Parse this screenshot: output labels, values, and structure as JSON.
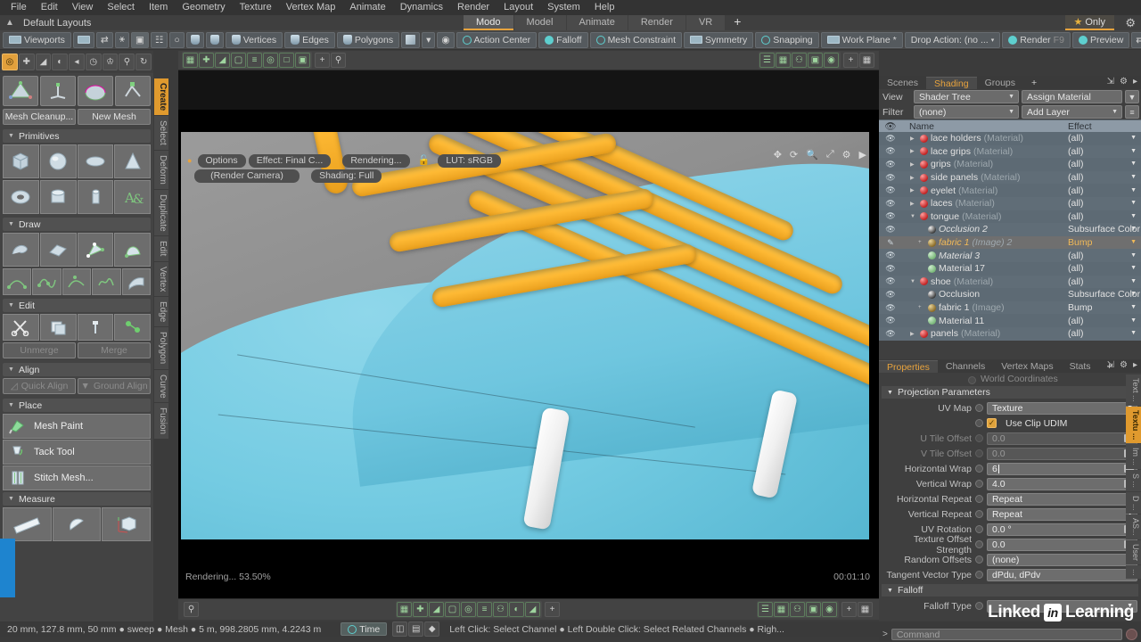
{
  "menu": {
    "items": [
      "File",
      "Edit",
      "View",
      "Select",
      "Item",
      "Geometry",
      "Texture",
      "Vertex Map",
      "Animate",
      "Dynamics",
      "Render",
      "Layout",
      "System",
      "Help"
    ]
  },
  "layoutbar": {
    "title": "Default Layouts",
    "tabs": [
      {
        "label": "Modo",
        "active": true
      },
      {
        "label": "Model",
        "active": false
      },
      {
        "label": "Animate",
        "active": false
      },
      {
        "label": "Render",
        "active": false
      },
      {
        "label": "VR",
        "active": false
      },
      {
        "label": "+",
        "active": false
      }
    ],
    "only_label": "Only",
    "star_icon": "star-icon",
    "gear_icon": "gear-icon"
  },
  "toolbar": {
    "viewports": "Viewports",
    "vertices": "Vertices",
    "edges": "Edges",
    "polygons": "Polygons",
    "action_center": "Action Center",
    "falloff": "Falloff",
    "mesh_constraint": "Mesh Constraint",
    "symmetry": "Symmetry",
    "snapping": "Snapping",
    "work_plane": "Work Plane *",
    "drop_action": "Drop Action: (no ...",
    "render": "Render",
    "render_key": "F9",
    "preview": "Preview",
    "overflow": ">>"
  },
  "left_tool_tabs": [
    "Create",
    "Select",
    "Deform",
    "Duplicate",
    "Edit",
    "Vertex",
    "Edge",
    "Polygon",
    "Curve",
    "Fusion"
  ],
  "left_tool_tab_active": "Create",
  "left_panel": {
    "buttons": [
      {
        "label": "Mesh Cleanup...",
        "dim": false
      },
      {
        "label": "New Mesh",
        "dim": false
      }
    ],
    "sections": [
      {
        "title": "Primitives"
      },
      {
        "title": "Draw"
      },
      {
        "title": "Edit"
      },
      {
        "title": "Align"
      },
      {
        "title": "Place"
      },
      {
        "title": "Measure"
      }
    ],
    "edit_buttons": [
      {
        "label": "Unmerge",
        "dim": true
      },
      {
        "label": "Merge",
        "dim": true
      }
    ],
    "align_buttons": [
      {
        "label": "Quick Align",
        "dim": true,
        "icon": "quick-align-icon"
      },
      {
        "label": "Ground Align",
        "dim": true,
        "icon": "ground-align-icon"
      }
    ],
    "place_items": [
      {
        "label": "Mesh Paint",
        "icon": "mesh-paint-icon"
      },
      {
        "label": "Tack Tool",
        "icon": "tack-tool-icon"
      },
      {
        "label": "Stitch Mesh...",
        "icon": "stitch-mesh-icon"
      }
    ]
  },
  "viewport": {
    "chips_row1": [
      "Options",
      "Effect: Final C...",
      "Rendering...",
      "LUT: sRGB"
    ],
    "chips_row2": [
      "(Render Camera)",
      "Shading: Full"
    ],
    "lock_icon": "unlock-icon",
    "nav_icons": [
      "pan-icon",
      "rotate-icon",
      "zoom-icon",
      "fit-icon",
      "gear-icon",
      "play-icon"
    ],
    "render_status": "Rendering... 53.50%",
    "render_time": "00:01:10"
  },
  "shader_tree": {
    "tabs": [
      {
        "label": "Scenes",
        "active": false
      },
      {
        "label": "Shading",
        "active": true
      },
      {
        "label": "Groups",
        "active": false
      },
      {
        "label": "+",
        "active": false
      }
    ],
    "view_label": "View",
    "view_value": "Shader Tree",
    "assign_material": "Assign Material",
    "filter_label": "Filter",
    "filter_value": "(none)",
    "add_layer": "Add Layer",
    "col_name": "Name",
    "col_effect": "Effect",
    "rows": [
      {
        "name": "lace holders",
        "type": "(Material)",
        "effect": "(all)",
        "indent": 1,
        "tri": "▶",
        "ball": "red",
        "selected": false,
        "italic": false
      },
      {
        "name": "lace grips",
        "type": "(Material)",
        "effect": "(all)",
        "indent": 1,
        "tri": "▶",
        "ball": "red",
        "selected": false,
        "italic": false
      },
      {
        "name": "grips",
        "type": "(Material)",
        "effect": "(all)",
        "indent": 1,
        "tri": "▶",
        "ball": "red",
        "selected": false,
        "italic": false
      },
      {
        "name": "side panels",
        "type": "(Material)",
        "effect": "(all)",
        "indent": 1,
        "tri": "▶",
        "ball": "red",
        "selected": false,
        "italic": false
      },
      {
        "name": "eyelet",
        "type": "(Material)",
        "effect": "(all)",
        "indent": 1,
        "tri": "▶",
        "ball": "red",
        "selected": false,
        "italic": false
      },
      {
        "name": "laces",
        "type": "(Material)",
        "effect": "(all)",
        "indent": 1,
        "tri": "▶",
        "ball": "red",
        "selected": false,
        "italic": false
      },
      {
        "name": "tongue",
        "type": "(Material)",
        "effect": "(all)",
        "indent": 1,
        "tri": "▼",
        "ball": "red",
        "selected": false,
        "italic": false
      },
      {
        "name": "Occlusion 2",
        "type": "",
        "effect": "Subsurface Color",
        "indent": 2,
        "tri": "",
        "ball": "dark",
        "selected": false,
        "italic": true
      },
      {
        "name": "fabric 1",
        "type": "(Image) 2",
        "effect": "Bump",
        "indent": 2,
        "tri": "+",
        "ball": "tan",
        "selected": true,
        "italic": true
      },
      {
        "name": "Material 3",
        "type": "",
        "effect": "(all)",
        "indent": 2,
        "tri": "",
        "ball": "green",
        "selected": false,
        "italic": true
      },
      {
        "name": "Material 17",
        "type": "",
        "effect": "(all)",
        "indent": 2,
        "tri": "",
        "ball": "green",
        "selected": false,
        "italic": false
      },
      {
        "name": "shoe",
        "type": "(Material)",
        "effect": "(all)",
        "indent": 1,
        "tri": "▼",
        "ball": "red",
        "selected": false,
        "italic": false
      },
      {
        "name": "Occlusion",
        "type": "",
        "effect": "Subsurface Color",
        "indent": 2,
        "tri": "",
        "ball": "dark",
        "selected": false,
        "italic": false
      },
      {
        "name": "fabric 1",
        "type": "(Image)",
        "effect": "Bump",
        "indent": 2,
        "tri": "+",
        "ball": "tan",
        "selected": false,
        "italic": false
      },
      {
        "name": "Material 11",
        "type": "",
        "effect": "(all)",
        "indent": 2,
        "tri": "",
        "ball": "green",
        "selected": false,
        "italic": false
      },
      {
        "name": "panels",
        "type": "(Material)",
        "effect": "(all)",
        "indent": 1,
        "tri": "▶",
        "ball": "red",
        "selected": false,
        "italic": false
      }
    ]
  },
  "properties": {
    "tabs": [
      {
        "label": "Properties",
        "active": true
      },
      {
        "label": "Channels",
        "active": false
      },
      {
        "label": "Vertex Maps",
        "active": false
      },
      {
        "label": "Stats",
        "active": false
      },
      {
        "label": "+",
        "active": false
      }
    ],
    "clipped_top": "World Coordinates",
    "section_projection": "Projection Parameters",
    "section_falloff": "Falloff",
    "fields": [
      {
        "label": "UV Map",
        "value": "Texture",
        "kind": "dropdown",
        "dim": false
      },
      {
        "label": "",
        "value": "Use Clip UDIM",
        "kind": "checkbox",
        "dim": false,
        "checked": true
      },
      {
        "label": "U Tile Offset",
        "value": "0.0",
        "kind": "number",
        "dim": true
      },
      {
        "label": "V Tile Offset",
        "value": "0.0",
        "kind": "number",
        "dim": true
      },
      {
        "label": "Horizontal Wrap",
        "value": "6",
        "kind": "number-edit",
        "dim": false
      },
      {
        "label": "Vertical Wrap",
        "value": "4.0",
        "kind": "number",
        "dim": false
      },
      {
        "label": "Horizontal Repeat",
        "value": "Repeat",
        "kind": "dropdown",
        "dim": false
      },
      {
        "label": "Vertical Repeat",
        "value": "Repeat",
        "kind": "dropdown",
        "dim": false
      },
      {
        "label": "UV Rotation",
        "value": "0.0 °",
        "kind": "number",
        "dim": false
      },
      {
        "label": "Texture Offset Strength",
        "value": "0.0",
        "kind": "number",
        "dim": false
      },
      {
        "label": "Random Offsets",
        "value": "(none)",
        "kind": "dropdown",
        "dim": false
      },
      {
        "label": "Tangent Vector Type",
        "value": "dPdu, dPdv",
        "kind": "dropdown",
        "dim": false
      }
    ],
    "falloff_type_label": "Falloff Type",
    "right_tabs": [
      "Text ...",
      "Textu ...",
      "Im ...",
      "S ...",
      "D ...",
      "AS...",
      "User",
      "..."
    ],
    "right_tab_active": "Textu ..."
  },
  "statusbar": {
    "measurements": "20 mm, 127.8 mm, 50 mm ● sweep ● Mesh ● 5 m, 998.2805 mm, 4.2243 m",
    "time_label": "Time",
    "hint": "Left Click: Select Channel ● Left Double Click: Select Related Channels ● Righ..."
  },
  "command_bar": {
    "prompt": ">",
    "placeholder": "Command"
  },
  "branding": {
    "linkedin": "Linked",
    "in": "in",
    "learning": "Learning"
  },
  "colors": {
    "accent": "#e8a33d",
    "panel": "#3f3f3f",
    "tree_row": "#5d6a74",
    "lace": "#fdb833",
    "shoe": "#74cbe2"
  }
}
